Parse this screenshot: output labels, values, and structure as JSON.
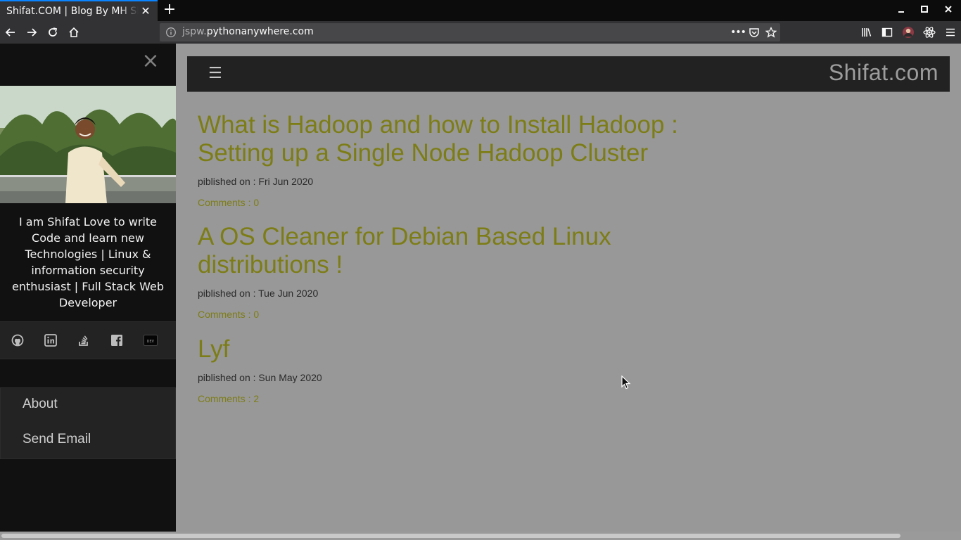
{
  "browser": {
    "tab_title": "Shifat.COM | Blog By MH Shifat",
    "tab_close": "✕",
    "new_tab": "+",
    "url_subdomain": "jspw.",
    "url_domain": "pythonanywhere.com",
    "url_actions": "•••"
  },
  "sidebar": {
    "close": "×",
    "bio": "I am Shifat Love to write Code and learn new Technologies | Linux & information security enthusiast | Full Stack Web Developer",
    "social": [
      "github-icon",
      "linkedin-icon",
      "stackoverflow-icon",
      "facebook-icon",
      "dev-icon"
    ],
    "menu": [
      {
        "label": "About"
      },
      {
        "label": "Send Email"
      }
    ]
  },
  "header": {
    "menu_glyph": "☰",
    "brand": "Shifat.com"
  },
  "posts": [
    {
      "title": "What is Hadoop and how to Install Hadoop : Setting up a Single Node Hadoop Cluster",
      "date": "piblished on : Fri Jun 2020",
      "comments": "Comments : 0"
    },
    {
      "title": "A OS Cleaner for Debian Based Linux distributions !",
      "date": "piblished on : Tue Jun 2020",
      "comments": "Comments : 0"
    },
    {
      "title": "Lyf",
      "date": "piblished on : Sun May 2020",
      "comments": "Comments : 2"
    }
  ],
  "colors": {
    "page_bg": "#989898",
    "sidebar_bg": "#111111",
    "accent": "#7d7d17",
    "topbar_bg": "#222222"
  }
}
